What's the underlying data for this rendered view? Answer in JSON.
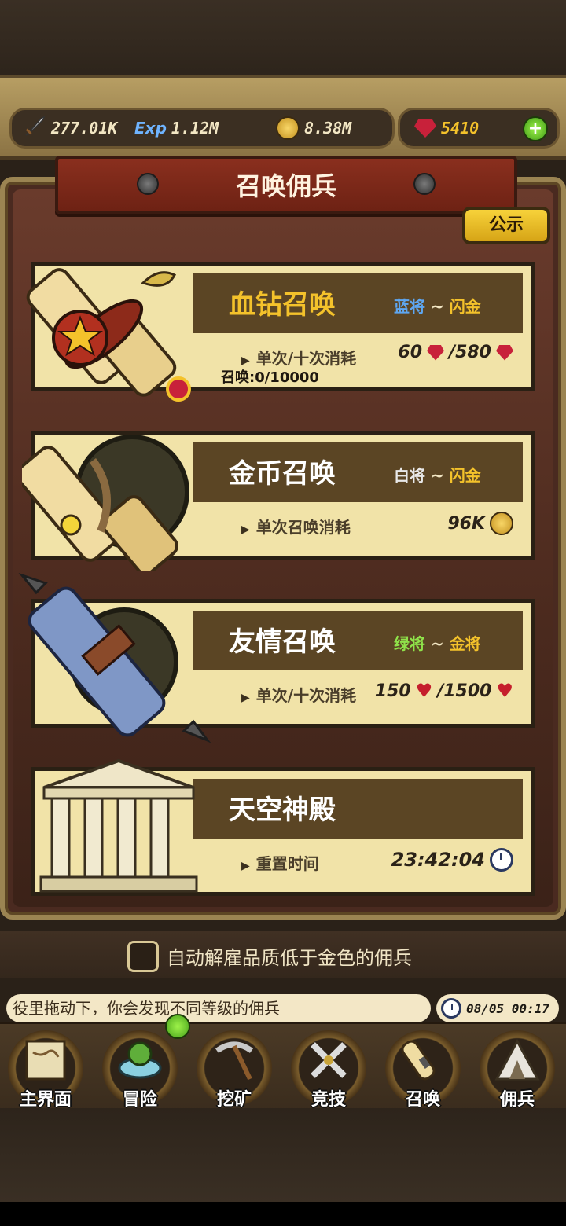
{
  "resources": {
    "power": "277.01K",
    "exp_label": "Exp",
    "exp": "1.12M",
    "gold": "8.38M",
    "gems": "5410",
    "add_icon": "plus-icon"
  },
  "header": {
    "title": "召唤佣兵",
    "notice_label": "公示"
  },
  "cards": [
    {
      "name": "血钻召唤",
      "range_from": "蓝将",
      "range_sep": " ~ ",
      "range_to": "闪金",
      "range_from_color": "#5ea6f0",
      "cost_label": "单次/十次消耗",
      "cost_single": "60",
      "cost_ten": "/580",
      "currency_icon": "ruby-icon",
      "counter": "召唤:0/10000"
    },
    {
      "name": "金币召唤",
      "range_from": "白将",
      "range_sep": " ~ ",
      "range_to": "闪金",
      "range_from_color": "#e8e8e8",
      "cost_label": "单次召唤消耗",
      "cost_single": "96K",
      "currency_icon": "coin-icon"
    },
    {
      "name": "友情召唤",
      "range_from": "绿将",
      "range_sep": " ~ ",
      "range_to": "金将",
      "range_from_color": "#8fe24a",
      "cost_label": "单次/十次消耗",
      "cost_single": "150",
      "cost_ten": "/1500",
      "currency_icon": "heart-icon"
    },
    {
      "name": "天空神殿",
      "cost_label": "重置时间",
      "timer": "23:42:04",
      "timer_icon": "clock-icon"
    }
  ],
  "auto_dismiss": {
    "label": "自动解雇品质低于金色的佣兵",
    "checked": false
  },
  "tip": "役里拖动下，你会发现不同等级的佣兵",
  "clock": "08/05 00:17",
  "nav": [
    {
      "label": "主界面",
      "icon": "map-icon"
    },
    {
      "label": "冒险",
      "icon": "island-icon"
    },
    {
      "label": "挖矿",
      "icon": "pickaxe-icon"
    },
    {
      "label": "竞技",
      "icon": "crossed-swords-icon"
    },
    {
      "label": "召唤",
      "icon": "scroll-icon"
    },
    {
      "label": "佣兵",
      "icon": "tent-icon"
    }
  ],
  "colors": {
    "accent_gold": "#f4c22b",
    "banner_red": "#8a2f1e",
    "card_bg": "#f1e3a8"
  }
}
